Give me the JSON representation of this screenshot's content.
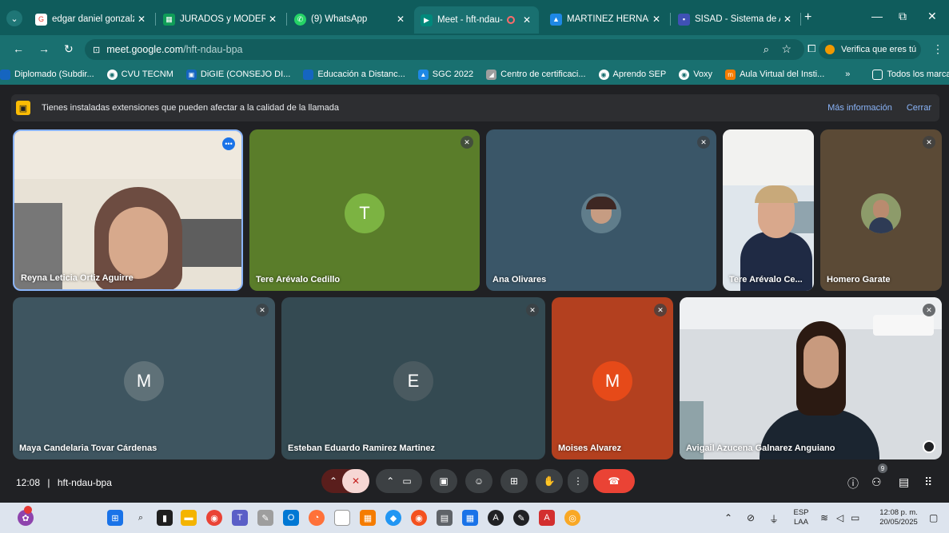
{
  "browser": {
    "tabs": [
      {
        "title": "edgar daniel gonzalz",
        "icon": "google-icon",
        "color": "#ffffff"
      },
      {
        "title": "JURADOS y MODERA",
        "icon": "sheets-icon",
        "color": "#0f9d58"
      },
      {
        "title": "(9) WhatsApp",
        "icon": "whatsapp-icon",
        "color": "#25d366"
      },
      {
        "title": "Meet - hft-ndau-",
        "icon": "meet-icon",
        "color": "#00897b",
        "active": true
      },
      {
        "title": "MARTINEZ HERNANI",
        "icon": "drive-icon",
        "color": "#1e88e5"
      },
      {
        "title": "SISAD - Sistema de A",
        "icon": "page-icon",
        "color": "#3f51b5"
      }
    ],
    "url_host": "meet.google.com",
    "url_path": "/hft-ndau-bpa",
    "verify_label": "Verifica que eres tú",
    "bookmarks": [
      {
        "label": "Diplomado (Subdir...",
        "color": "#1565c0"
      },
      {
        "label": "CVU TECNM",
        "color": "#ffffff"
      },
      {
        "label": "DiGIE (CONSEJO DI...",
        "color": "#1565c0"
      },
      {
        "label": "Educación a Distanc...",
        "color": "#1565c0"
      },
      {
        "label": "SGC 2022",
        "color": "#1e88e5"
      },
      {
        "label": "Centro de certificaci...",
        "color": "#9e9e9e"
      },
      {
        "label": "Aprendo SEP",
        "color": "#ffffff"
      },
      {
        "label": "Voxy",
        "color": "#ffffff"
      },
      {
        "label": "Aula Virtual del Insti...",
        "color": "#f57c00"
      }
    ],
    "more_bookmarks": "»",
    "all_bookmarks": "Todos los marcadores"
  },
  "banner": {
    "text": "Tienes instaladas extensiones que pueden afectar a la calidad de la llamada",
    "more_info": "Más información",
    "close": "Cerrar"
  },
  "participants": [
    {
      "name": "Reyna Leticia Ortiz Aguirre",
      "type": "video",
      "speaking": true
    },
    {
      "name": "Tere Arévalo Cedillo",
      "type": "letter",
      "letter": "T",
      "tile_color": "#5a7d2a",
      "avatar_color": "#7cb342"
    },
    {
      "name": "Ana Olivares",
      "type": "photo",
      "tile_color": "#3a5668"
    },
    {
      "name": "Tere Arévalo Ce...",
      "type": "video"
    },
    {
      "name": "Homero Garate",
      "type": "photo",
      "tile_color": "#5b4a36"
    },
    {
      "name": "Maya Candelaria Tovar Cárdenas",
      "type": "letter",
      "letter": "M",
      "tile_color": "#3e5560",
      "avatar_color": "#5f7178"
    },
    {
      "name": "Esteban Eduardo Ramirez Martinez",
      "type": "letter",
      "letter": "E",
      "tile_color": "#344a52",
      "avatar_color": "#4a5a60"
    },
    {
      "name": "Moises Alvarez",
      "type": "letter",
      "letter": "M",
      "tile_color": "#b3401f",
      "avatar_color": "#e64a19"
    },
    {
      "name": "Avigail Azucena Galnarez Anguiano",
      "type": "video"
    }
  ],
  "meeting": {
    "time": "12:08",
    "separator": "|",
    "code": "hft-ndau-bpa",
    "people_count": "9"
  },
  "taskbar": {
    "language": "ESP",
    "layout": "LAA",
    "time": "12:08 p. m.",
    "date": "20/05/2025"
  }
}
